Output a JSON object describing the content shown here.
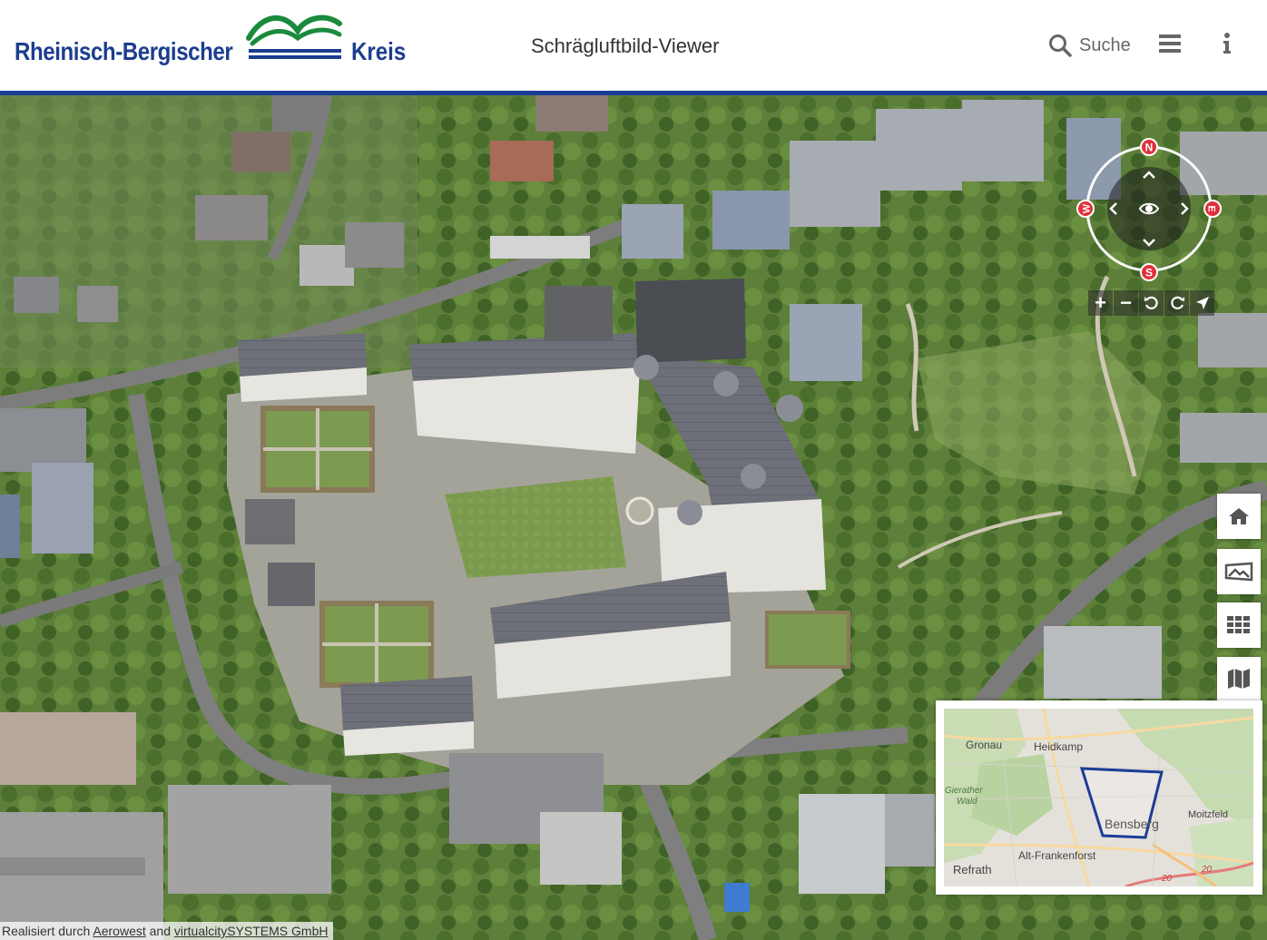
{
  "header": {
    "logo": {
      "text_left": "Rheinisch-Bergischer",
      "text_right": "Kreis",
      "brand_color": "#1c3d8f",
      "mark_color": "#1a8a3c"
    },
    "app_title": "Schrägluftbild-Viewer",
    "search_label": "Suche",
    "accent_color": "#1a3d96"
  },
  "compass": {
    "north": "N",
    "south": "S",
    "east": "E",
    "west": "W",
    "marker_color": "#e0303a"
  },
  "map_controls": {
    "zoom_in": "+",
    "zoom_out": "−"
  },
  "side_toolbar": {
    "icons": [
      "home-icon",
      "image-icon",
      "grid-icon",
      "map-icon"
    ]
  },
  "overview_map": {
    "places": {
      "gronau": "Gronau",
      "heidkamp": "Heidkamp",
      "gierather_wald_1": "Gierather",
      "gierather_wald_2": "Wald",
      "bensberg": "Bensberg",
      "moitzfeld": "Moitzfeld",
      "alt_frankenforst": "Alt-Frankenforst",
      "refrath": "Refrath",
      "road_1": "20",
      "road_2": "20"
    },
    "frame_color": "#1a3d96"
  },
  "attribution": {
    "prefix": "Realisiert durch ",
    "link1": "Aerowest",
    "mid": " and ",
    "link2": "virtualcitySYSTEMS GmbH"
  }
}
